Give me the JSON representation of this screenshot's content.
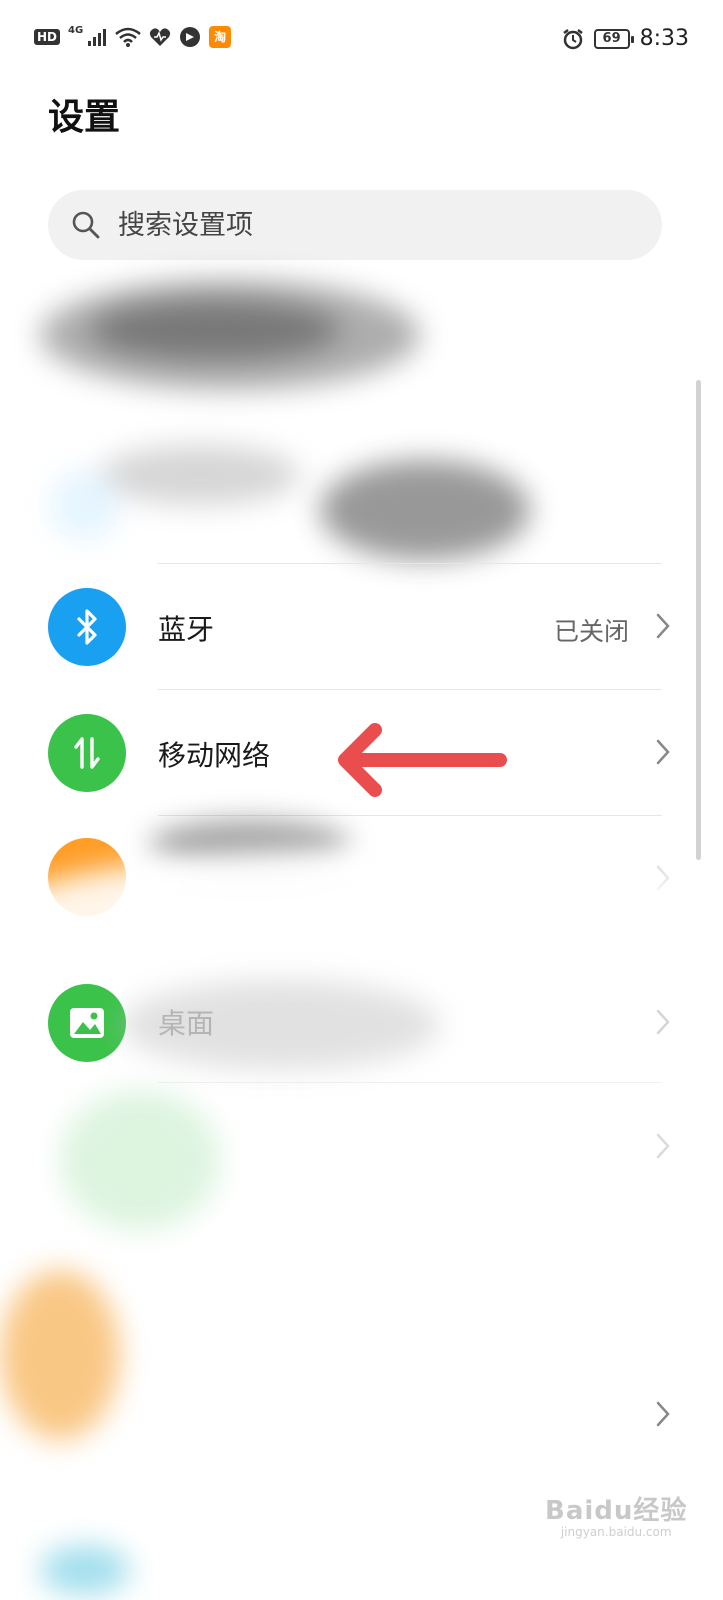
{
  "status_bar": {
    "hd_label": "HD",
    "network_type": "4G",
    "taobao_label": "淘",
    "battery_level": "69",
    "time": "8:33",
    "icons": [
      "signal-icon",
      "wifi-icon",
      "health-icon",
      "app-icon",
      "taobao-icon",
      "alarm-icon",
      "battery-icon"
    ]
  },
  "page": {
    "title": "设置"
  },
  "search": {
    "placeholder": "搜索设置项"
  },
  "settings_items": [
    {
      "label": "蓝牙",
      "value": "已关闭",
      "icon": "bluetooth-icon",
      "color": "#1aa0f0"
    },
    {
      "label": "移动网络",
      "value": "",
      "icon": "mobile-data-icon",
      "color": "#3bc24a"
    },
    {
      "label": "桌面",
      "value": "",
      "icon": "wallpaper-icon",
      "color": "#3bc24a"
    }
  ],
  "annotation": {
    "arrow_color": "#ea4d4d",
    "icon": "red-arrow-icon"
  },
  "watermark": {
    "main": "Baidu经验",
    "sub": "jingyan.baidu.com"
  }
}
